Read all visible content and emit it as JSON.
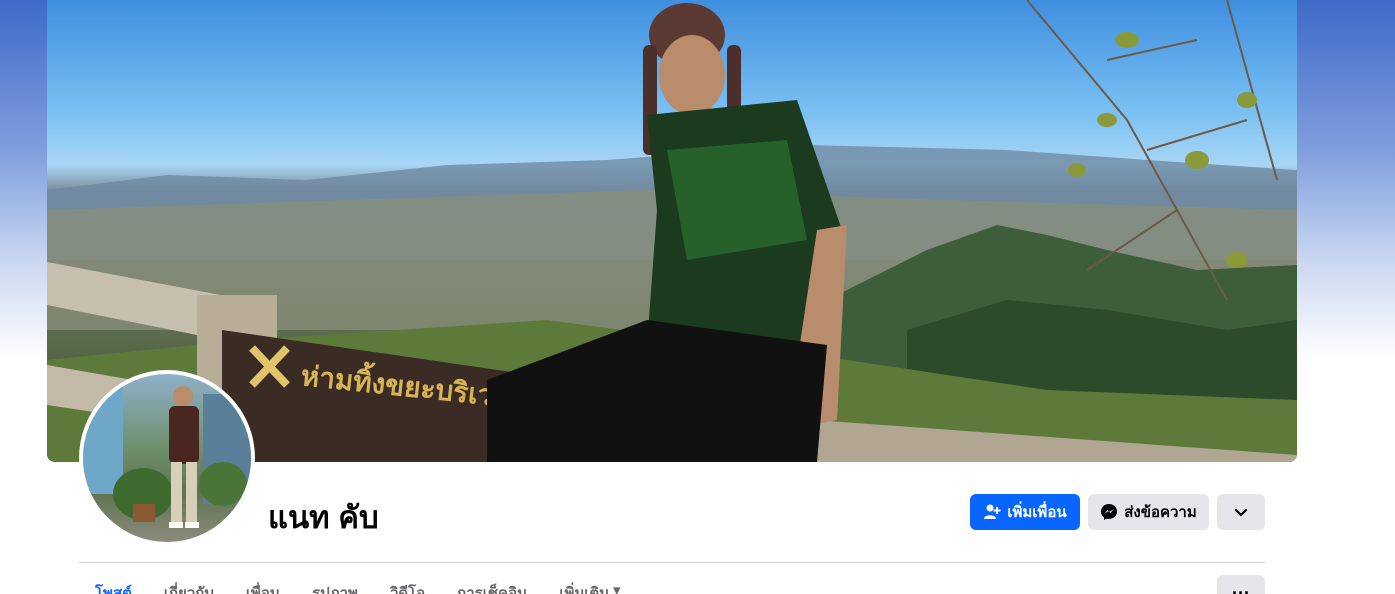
{
  "profile": {
    "name": "แนท คับ",
    "cover_sign_text": "ห่ามทิ้งขยะบริเวณนี้"
  },
  "actions": {
    "add_friend_label": "เพิ่มเพื่อน",
    "message_label": "ส่งข้อความ",
    "add_friend_icon": "person-add-icon",
    "message_icon": "messenger-icon",
    "more_icon": "chevron-down-icon"
  },
  "tabs": [
    {
      "label": "โพสต์"
    },
    {
      "label": "เกี่ยวกับ"
    },
    {
      "label": "เพื่อน"
    },
    {
      "label": "รูปภาพ"
    },
    {
      "label": "วิดีโอ"
    },
    {
      "label": "การเช็คอิน"
    },
    {
      "label": "เพิ่มเติม"
    }
  ],
  "tab_overflow_label": "···",
  "colors": {
    "accent": "#0866ff",
    "secondary_button": "#e4e6eb"
  }
}
